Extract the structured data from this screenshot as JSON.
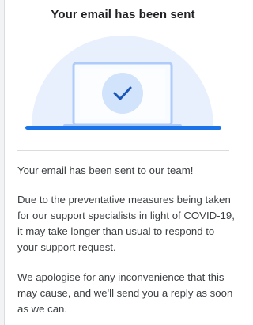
{
  "dialog": {
    "title": "Your email has been sent",
    "illustration_icon": "checkmark-icon",
    "messages": [
      "Your email has been sent to our team!",
      "Due to the preventative measures being taken for our support specialists in light of COVID-19, it may take longer than usual to respond to your support request.",
      "We apologise for any inconvenience that this may cause, and we'll send you a reply as soon as we can."
    ]
  },
  "colors": {
    "accent_blue": "#1a73e8",
    "illustration_light_blue": "#e8f0fe",
    "laptop_frame": "#aecbfa",
    "check_circle": "#d2e3fc"
  }
}
